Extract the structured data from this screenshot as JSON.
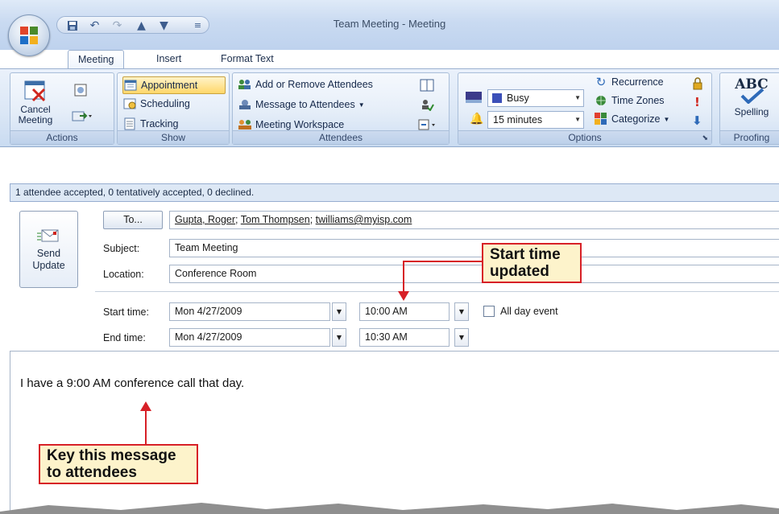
{
  "window": {
    "title": "Team Meeting - Meeting"
  },
  "tabs": [
    {
      "label": "Meeting"
    },
    {
      "label": "Insert"
    },
    {
      "label": "Format Text"
    }
  ],
  "ribbon": {
    "actions": {
      "label": "Actions",
      "cancel": "Cancel Meeting"
    },
    "show": {
      "label": "Show",
      "appointment": "Appointment",
      "scheduling": "Scheduling",
      "tracking": "Tracking"
    },
    "attendees": {
      "label": "Attendees",
      "add_remove": "Add or Remove Attendees",
      "message": "Message to Attendees",
      "workspace": "Meeting Workspace"
    },
    "options": {
      "label": "Options",
      "busy": "Busy",
      "reminder": "15 minutes",
      "recurrence": "Recurrence",
      "timezones": "Time Zones",
      "categorize": "Categorize"
    },
    "proofing": {
      "label": "Proofing",
      "spelling": "Spelling",
      "abc": "ABC"
    }
  },
  "infobar": {
    "text": "1 attendee accepted, 0 tentatively accepted, 0 declined."
  },
  "form": {
    "send_update": "Send Update",
    "to_button": "To...",
    "attendees": [
      "Gupta, Roger",
      "Tom Thompsen",
      "twilliams@myisp.com"
    ],
    "subject_label": "Subject:",
    "subject_value": "Team Meeting",
    "location_label": "Location:",
    "location_value": "Conference Room",
    "start_label": "Start time:",
    "start_date": "Mon 4/27/2009",
    "start_time": "10:00 AM",
    "all_day": "All day event",
    "end_label": "End time:",
    "end_date": "Mon 4/27/2009",
    "end_time": "10:30 AM"
  },
  "body": {
    "message": "I have a 9:00 AM conference call that day."
  },
  "callouts": {
    "start_time": "Start time updated",
    "key_message": "Key this message to attendees"
  },
  "colors": {
    "callout_border": "#d72027",
    "callout_fill": "#fdf3cb",
    "ribbon": "#dbe7f6"
  }
}
